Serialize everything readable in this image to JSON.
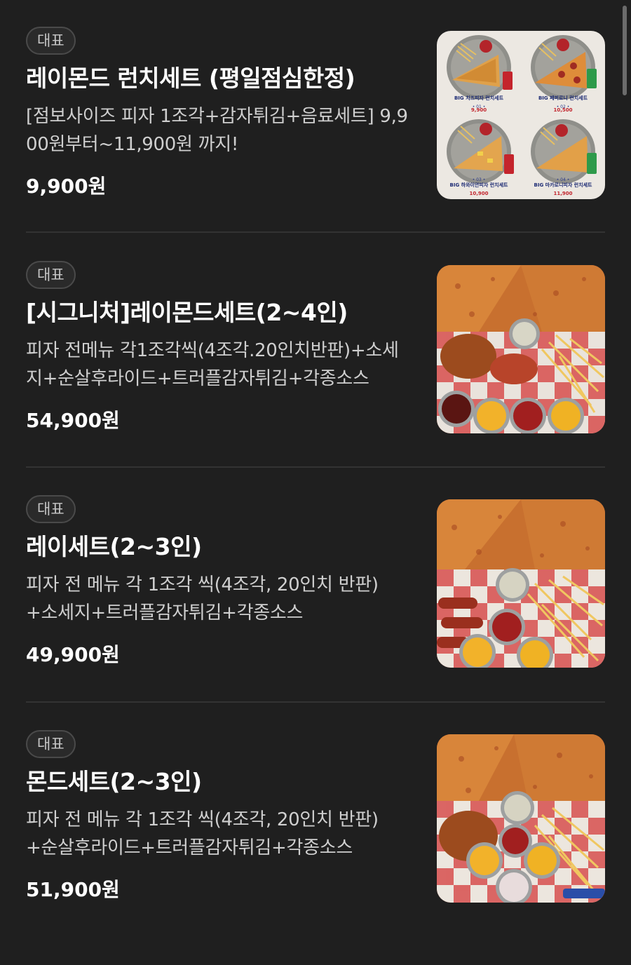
{
  "menu": {
    "items": [
      {
        "badge": "대표",
        "title": "레이몬드 런치세트 (평일점심한정)",
        "description": "[점보사이즈 피자 1조각+감자튀김+음료세트] 9,900원부터~11,900원 까지!",
        "price": "9,900원",
        "image_icon": "lunch-set-photo",
        "image_labels": {
          "set1_number": "• 01 •",
          "set1_name": "BIG 치즈피자 런치세트",
          "set1_price": "9,900",
          "set2_number": "• 02 •",
          "set2_name": "BIG 페퍼로니 런치세트",
          "set2_price": "10,500",
          "set3_number": "• 03 •",
          "set3_name": "BIG 하와이안피자 런치세트",
          "set3_price": "10,900",
          "set4_number": "• 04 •",
          "set4_name": "BIG 마카로니피자 런치세트",
          "set4_price": "11,900"
        }
      },
      {
        "badge": "대표",
        "title": "[시그니처]레이몬드세트(2~4인)",
        "description": "피자 전메뉴 각1조각씩(4조각.20인치반판)+소세지+순살후라이드+트러플감자튀김+각종소스",
        "price": "54,900원",
        "image_icon": "signature-set-photo"
      },
      {
        "badge": "대표",
        "title": "레이세트(2~3인)",
        "description": "피자 전 메뉴 각 1조각 씩(4조각, 20인치 반판)+소세지+트러플감자튀김+각종소스",
        "price": "49,900원",
        "image_icon": "ray-set-photo"
      },
      {
        "badge": "대표",
        "title": "몬드세트(2~3인)",
        "description": "피자 전 메뉴 각 1조각 씩(4조각, 20인치 반판)+순살후라이드+트러플감자튀김+각종소스",
        "price": "51,900원",
        "image_icon": "mond-set-photo"
      }
    ]
  },
  "colors": {
    "background": "#1f1f1f",
    "text_primary": "#ffffff",
    "text_secondary": "#cfcfcf",
    "badge_border": "#4a4a4a",
    "divider": "#333333"
  }
}
